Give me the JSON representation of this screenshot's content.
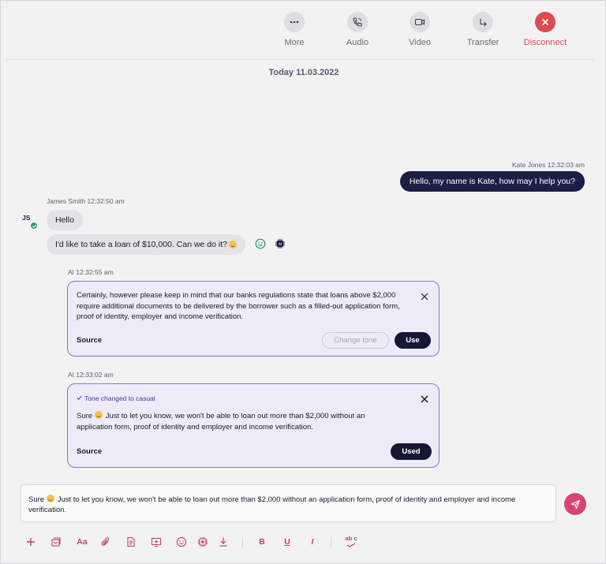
{
  "toolbar": {
    "more_label": "More",
    "audio_label": "Audio",
    "video_label": "Video",
    "transfer_label": "Transfer",
    "disconnect_label": "Disconnect",
    "disconnect_color": "#dd4b52"
  },
  "date_separator": "Today 11.03.2022",
  "messages": {
    "agent_meta": "Kate Jones 12:32:03 am",
    "agent_text": "Hello, my name is Kate, how may I help you?",
    "customer_meta": "James Smith 12:32:50 am",
    "customer_initials": "JS",
    "customer_text_1": "Hello",
    "customer_text_2": "I'd like to take a loan of $10,000. Can we do it?",
    "icons": [
      "smile-icon",
      "ai-chip-icon"
    ]
  },
  "ai_suggestions": [
    {
      "meta": "AI 12:32:55 am",
      "text": "Certainly, however please keep in mind that our banks regulations state that loans above $2,000 require additional documents to be delivered by the borrower such as a filled-out application form, proof of identity, employer and income verification.",
      "source_label": "Source",
      "change_tone_label": "Change tone",
      "use_label": "Use"
    },
    {
      "meta": "AI 12:33:02 am",
      "tone_note": "Tone changed to casual",
      "text_before_emoji": "Sure",
      "text": " Just to let you know, we won't be able to loan out more than $2,000 without an application form, proof of identity and employer and income verification.",
      "source_label": "Source",
      "used_label": "Used"
    }
  ],
  "composer": {
    "text_before_emoji": "Sure",
    "text": " Just to let you know, we won't be able to loan out more than $2,000 without an application form, proof of identity and employer and income verification."
  },
  "format_bar": {
    "font_label": "Aa",
    "bold_label": "B",
    "underline_label": "U",
    "italic_label": "I",
    "spellcheck_label": "ab c",
    "icons": [
      "plus-icon",
      "template-icon",
      "font-icon",
      "attachment-icon",
      "document-icon",
      "screen-share-icon",
      "emoji-icon",
      "ai-chip-icon",
      "download-icon",
      "bold-icon",
      "underline-icon",
      "italic-icon",
      "spellcheck-icon"
    ]
  },
  "colors": {
    "accent": "#c43f6c",
    "send": "#d64472",
    "agent_bubble": "#1c1f45",
    "ai_border": "#7b79d6",
    "ai_bg": "#ecebf7"
  }
}
